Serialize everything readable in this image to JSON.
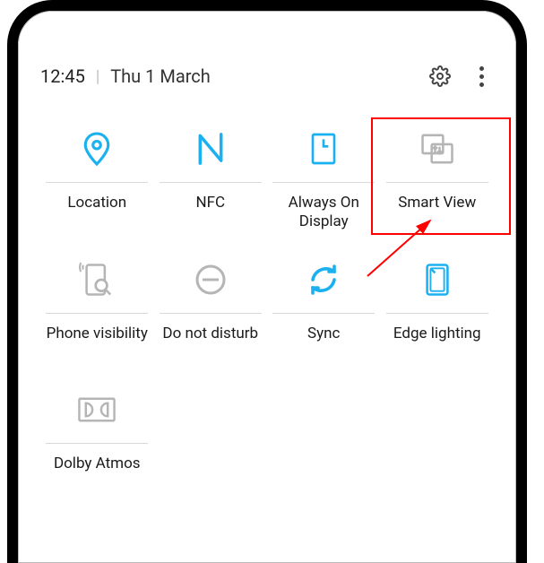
{
  "status": {
    "time": "12:45",
    "date": "Thu 1 March"
  },
  "icons": {
    "settings": "gear",
    "more": "more-vertical"
  },
  "tiles": [
    {
      "id": "location",
      "label": "Location",
      "icon": "location-pin",
      "active": true
    },
    {
      "id": "nfc",
      "label": "NFC",
      "icon": "nfc",
      "active": true
    },
    {
      "id": "aod",
      "label": "Always On Display",
      "icon": "always-on-display",
      "active": true
    },
    {
      "id": "smartview",
      "label": "Smart View",
      "icon": "smart-view",
      "active": false,
      "highlighted": true
    },
    {
      "id": "phonevis",
      "label": "Phone visibility",
      "icon": "phone-visibility",
      "active": false
    },
    {
      "id": "dnd",
      "label": "Do not disturb",
      "icon": "do-not-disturb",
      "active": false
    },
    {
      "id": "sync",
      "label": "Sync",
      "icon": "sync",
      "active": true
    },
    {
      "id": "edge",
      "label": "Edge lighting",
      "icon": "edge-lighting",
      "active": true
    },
    {
      "id": "dolby",
      "label": "Dolby Atmos",
      "icon": "dolby-atmos",
      "active": false
    }
  ],
  "colors": {
    "active": "#1bb0f0",
    "inactive": "#b5b5b5",
    "text": "#1a1a1a",
    "highlight": "#ff0000"
  }
}
